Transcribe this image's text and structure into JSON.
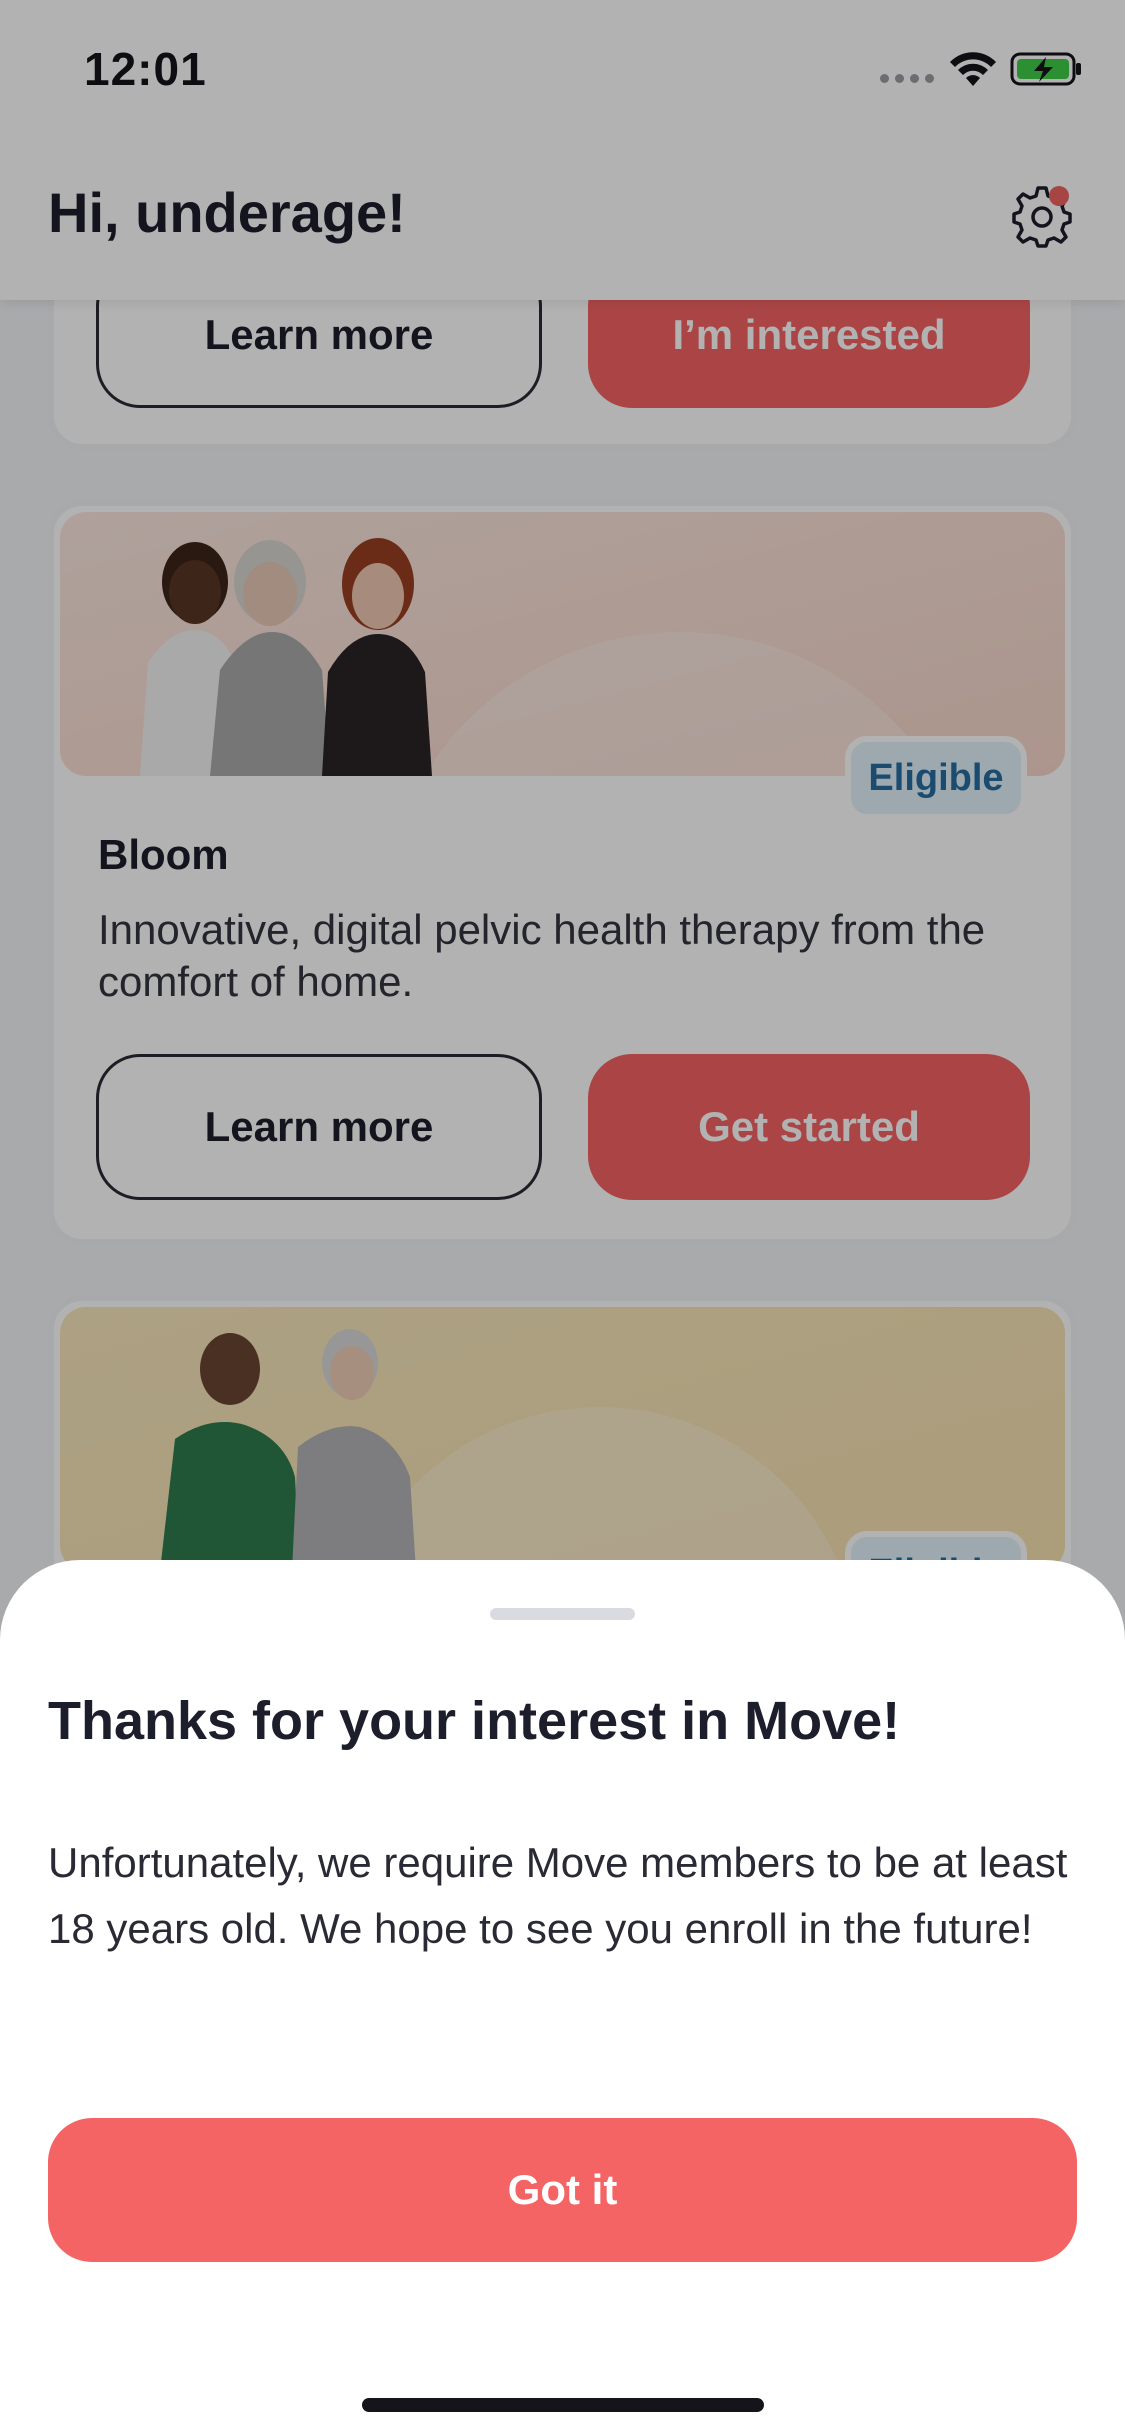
{
  "status_bar": {
    "time": "12:01"
  },
  "header": {
    "greeting": "Hi, underage!",
    "settings_icon": "gear-icon",
    "has_notification": true
  },
  "cards": {
    "top": {
      "learn_more": "Learn more",
      "action": "I’m interested"
    },
    "bloom": {
      "badge": "Eligible",
      "title": "Bloom",
      "description": "Innovative, digital pelvic health therapy from the comfort of home.",
      "learn_more": "Learn more",
      "action": "Get started"
    },
    "move": {
      "badge": "Eligible"
    }
  },
  "sheet": {
    "title": "Thanks for your interest in Move!",
    "body": "Unfortunately, we require Move members to be at least 18 years old. We hope to see you enroll in the future!",
    "button": "Got it"
  },
  "colors": {
    "accent_red": "#f56464",
    "eligible_text": "#276c9f",
    "eligible_bg": "#e3f2fb",
    "dark_text": "#1d1e2c"
  }
}
